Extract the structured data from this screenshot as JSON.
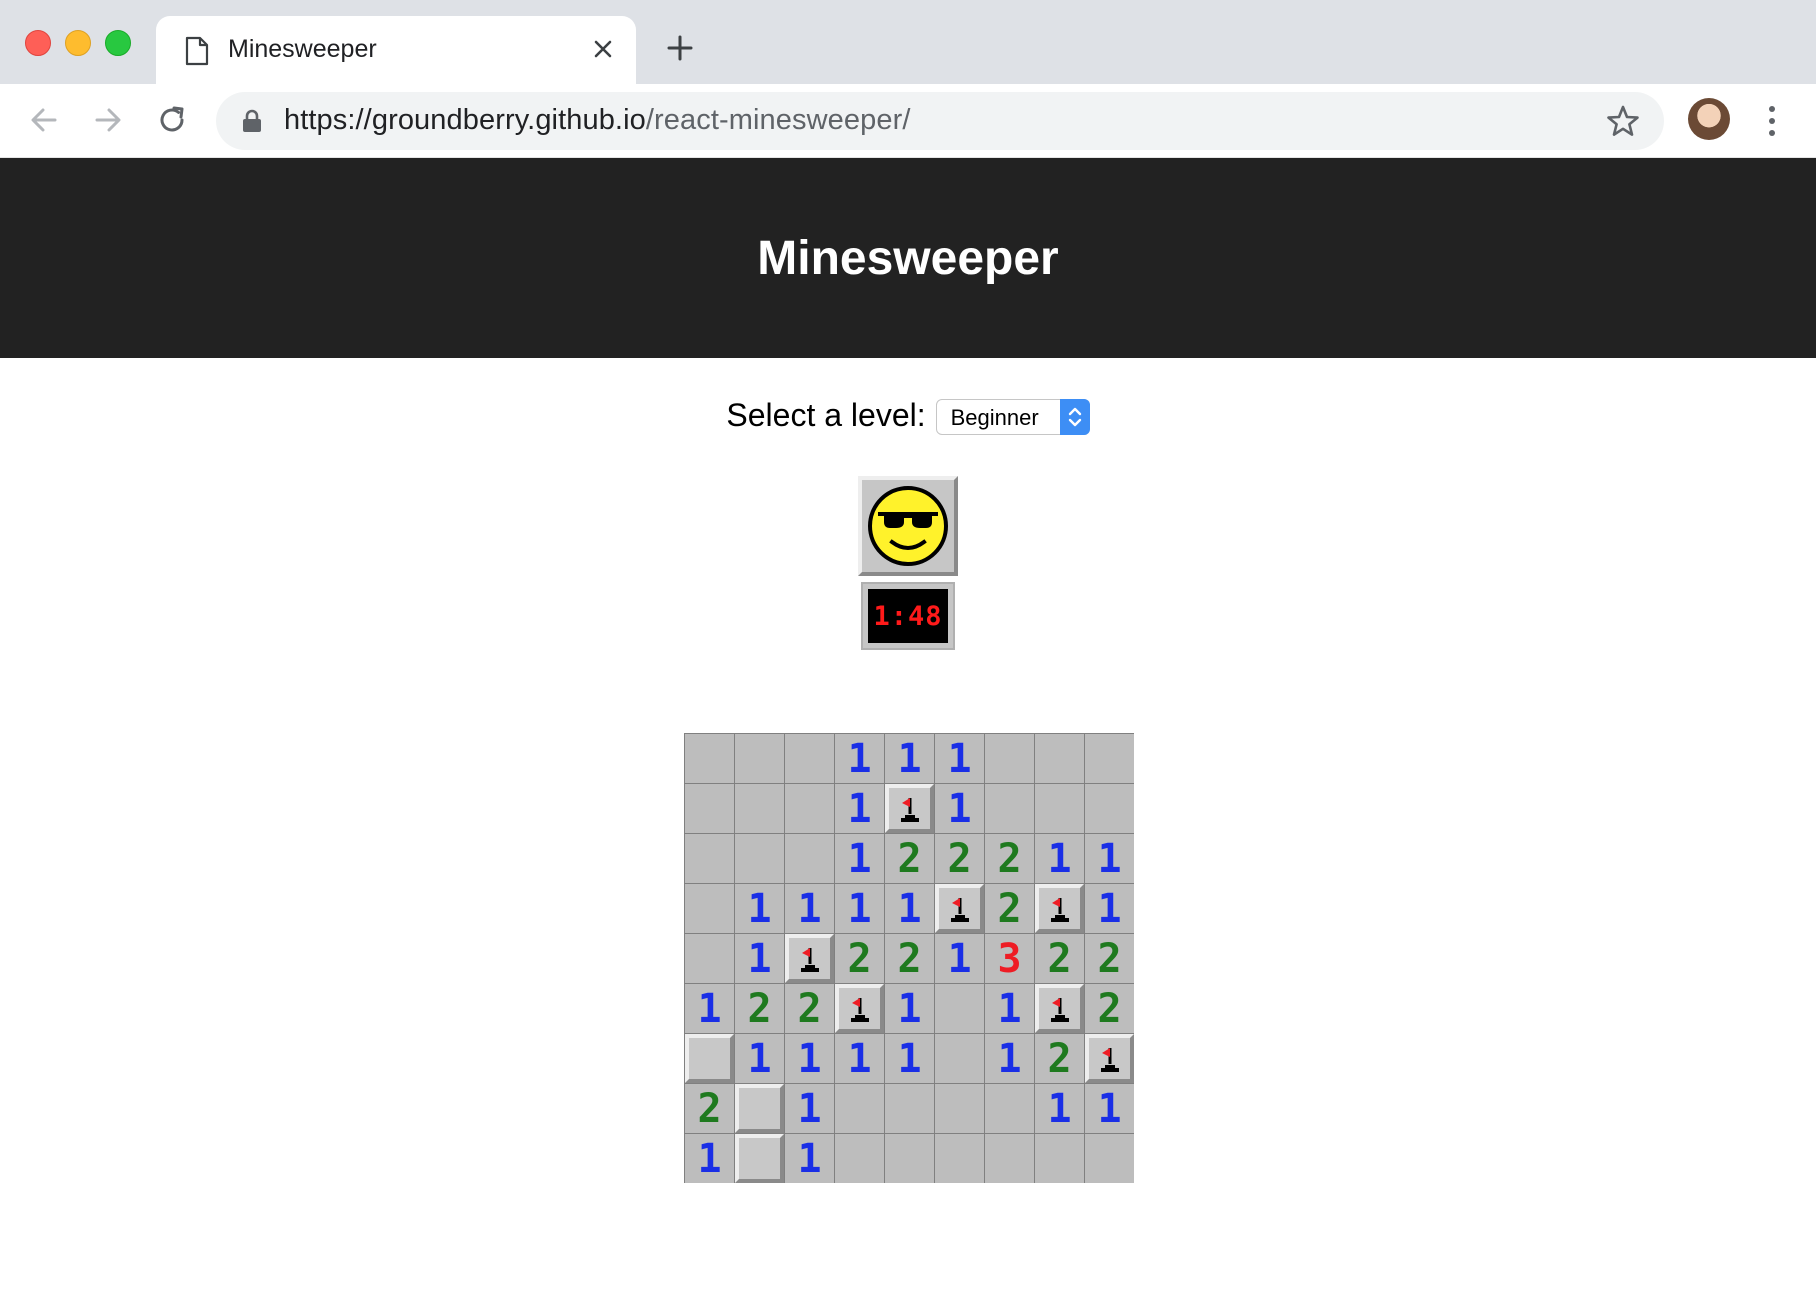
{
  "browser": {
    "tab_title": "Minesweeper",
    "url_host": "https://groundberry.github.io",
    "url_path": "/react-minesweeper/"
  },
  "page": {
    "title": "Minesweeper",
    "level_label": "Select a level:",
    "level_selected": "Beginner",
    "timer": "1:48",
    "face": "cool-sunglasses-face"
  },
  "colors": {
    "one": "#1a2ee6",
    "two": "#1f7a1f",
    "three": "#ee1c24",
    "header_bg": "#222222"
  },
  "board": {
    "rows": [
      [
        "",
        "",
        "",
        "1",
        "1",
        "1",
        "",
        "",
        ""
      ],
      [
        "",
        "",
        "",
        "1",
        "F",
        "1",
        "",
        "",
        ""
      ],
      [
        "",
        "",
        "",
        "1",
        "2",
        "2",
        "2",
        "1",
        "1"
      ],
      [
        "",
        "1",
        "1",
        "1",
        "1",
        "F",
        "2",
        "F",
        "1"
      ],
      [
        "",
        "1",
        "F",
        "2",
        "2",
        "1",
        "3",
        "2",
        "2"
      ],
      [
        "1",
        "2",
        "2",
        "F",
        "1",
        "",
        "1",
        "F",
        "2"
      ],
      [
        "U",
        "1",
        "1",
        "1",
        "1",
        "",
        "1",
        "2",
        "F"
      ],
      [
        "2",
        "U",
        "1",
        "",
        "",
        "",
        "",
        "1",
        "1"
      ],
      [
        "1",
        "U",
        "1",
        "",
        "",
        "",
        "",
        "",
        ""
      ]
    ],
    "legend": {
      "F": "flag",
      "U": "unrevealed",
      "": "empty revealed"
    }
  }
}
